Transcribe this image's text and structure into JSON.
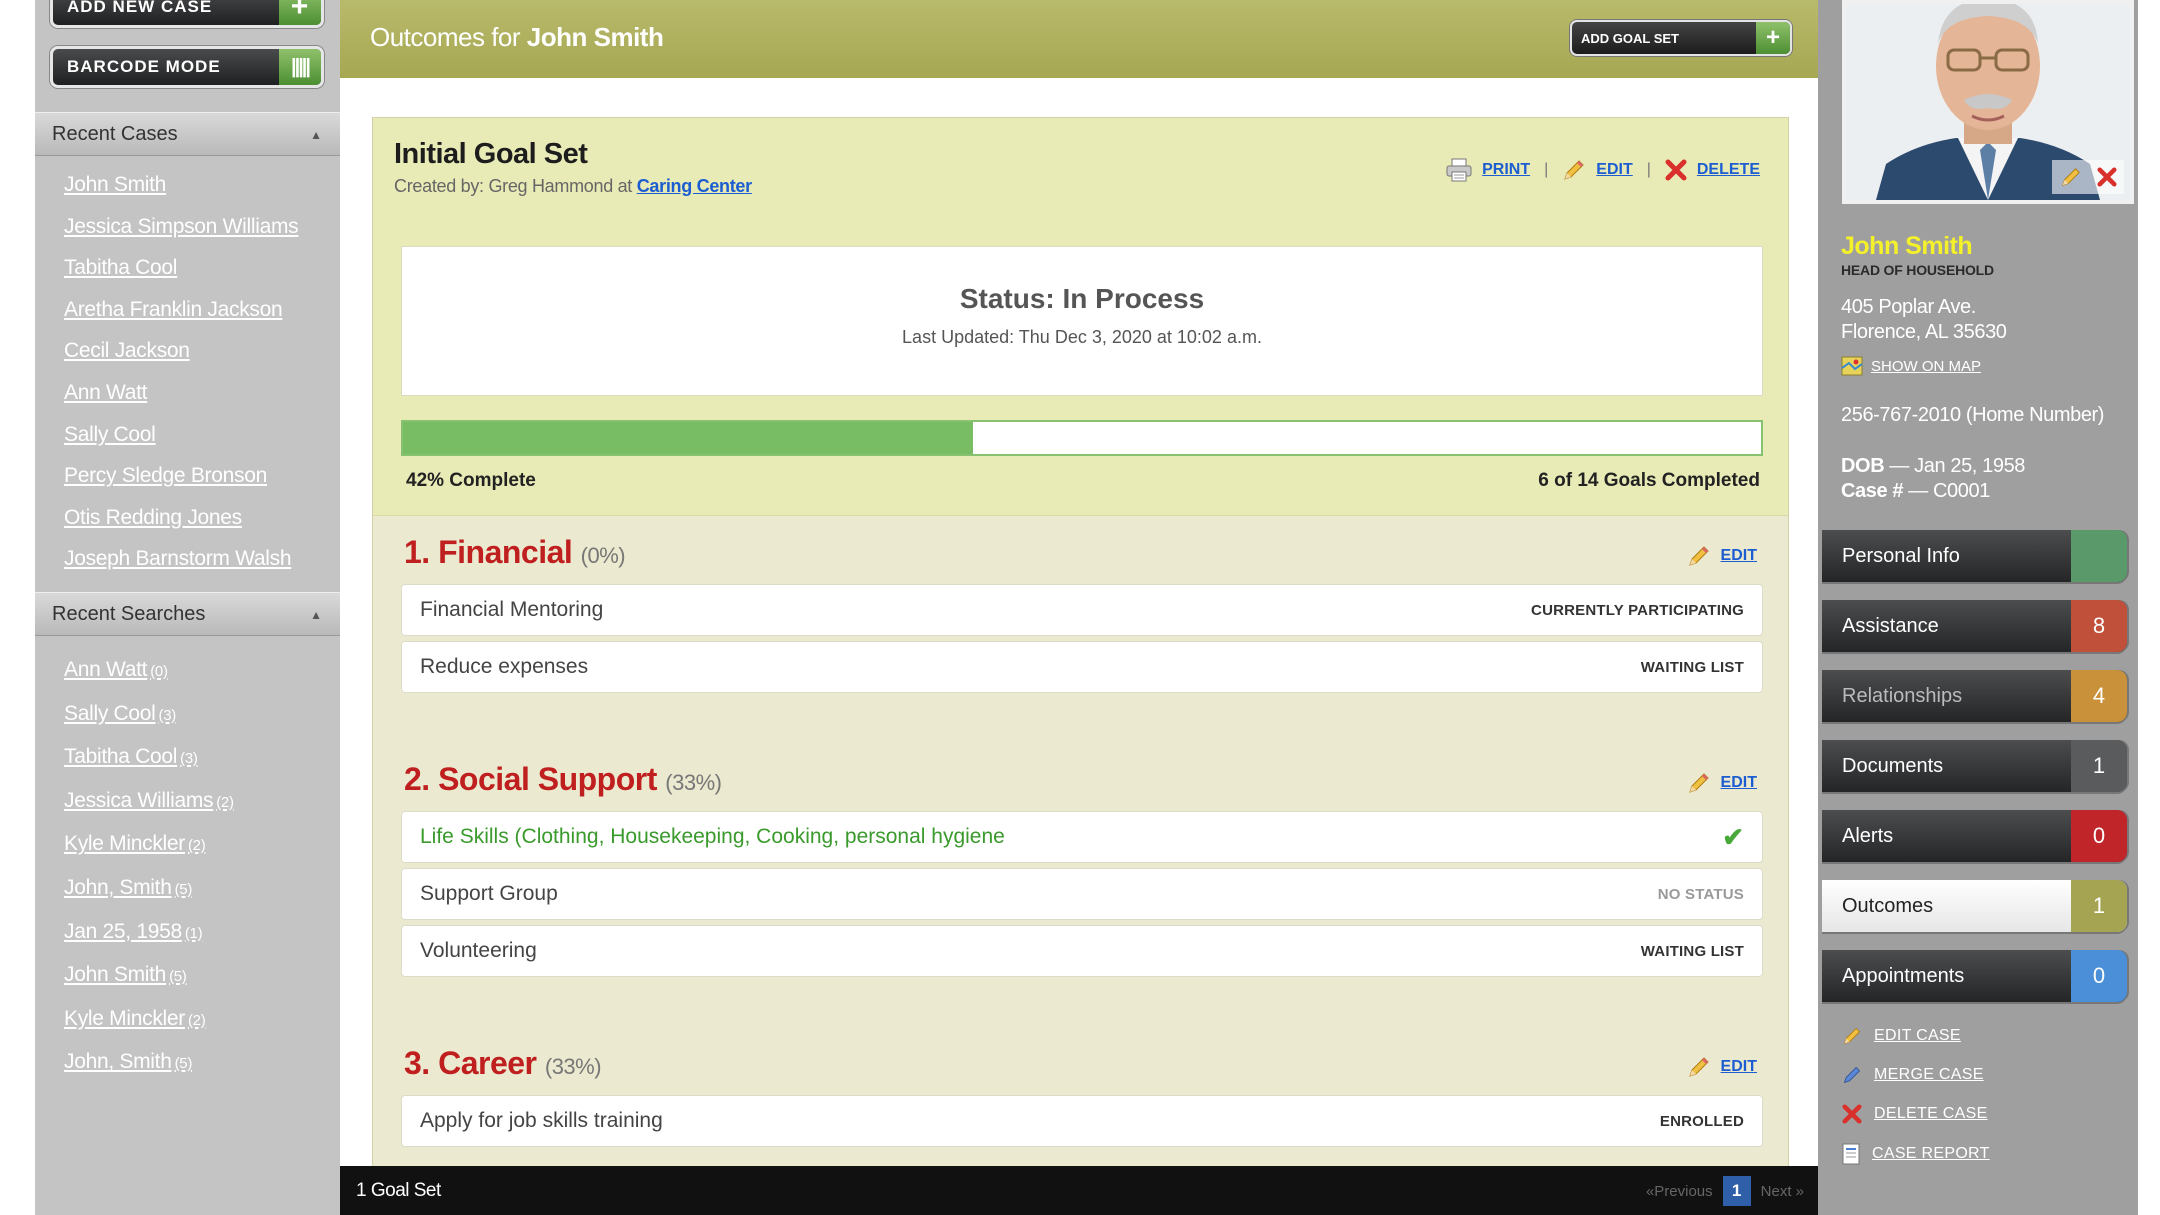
{
  "left_sidebar": {
    "add_new_case": "ADD NEW CASE",
    "barcode_mode": "BARCODE MODE",
    "recent_cases_heading": "Recent Cases",
    "recent_cases": [
      "John Smith",
      "Jessica Simpson Williams",
      "Tabitha Cool",
      "Aretha Franklin Jackson",
      "Cecil Jackson",
      "Ann Watt",
      "Sally Cool",
      "Percy Sledge Bronson",
      "Otis Redding Jones",
      "Joseph Barnstorm Walsh"
    ],
    "recent_searches_heading": "Recent Searches",
    "recent_searches": [
      {
        "label": "Ann Watt",
        "count": "(0)"
      },
      {
        "label": "Sally Cool",
        "count": "(3)"
      },
      {
        "label": "Tabitha Cool",
        "count": "(3)"
      },
      {
        "label": "Jessica Williams",
        "count": "(2)"
      },
      {
        "label": "Kyle Minckler",
        "count": "(2)"
      },
      {
        "label": "John, Smith",
        "count": "(5)"
      },
      {
        "label": "Jan 25, 1958",
        "count": "(1)"
      },
      {
        "label": "John Smith",
        "count": "(5)"
      },
      {
        "label": "Kyle Minckler",
        "count": "(2)"
      },
      {
        "label": "John, Smith",
        "count": "(5)"
      }
    ]
  },
  "header": {
    "title_prefix": "Outcomes for",
    "title_name": "John Smith",
    "add_goal_set": "ADD GOAL SET"
  },
  "goal_set": {
    "title": "Initial Goal Set",
    "created_by_prefix": "Created by: Greg Hammond at",
    "created_by_location": "Caring Center",
    "print": "PRINT",
    "edit": "EDIT",
    "delete": "DELETE",
    "separator": "|",
    "status": "Status: In Process",
    "last_updated": "Last Updated: Thu Dec 3, 2020 at 10:02 a.m.",
    "progress_fraction": 0.42,
    "progress_label": "42% Complete",
    "goals_completed": "6 of 14 Goals Completed",
    "sections": [
      {
        "title": "1. Financial",
        "pct": "(0%)",
        "edit": "EDIT",
        "goals": [
          {
            "name": "Financial Mentoring",
            "status": "CURRENTLY PARTICIPATING"
          },
          {
            "name": "Reduce expenses",
            "status": "WAITING LIST"
          }
        ]
      },
      {
        "title": "2. Social Support",
        "pct": "(33%)",
        "edit": "EDIT",
        "goals": [
          {
            "name": "Life Skills (Clothing, Housekeeping, Cooking, personal hygiene",
            "status": ""
          },
          {
            "name": "Support Group",
            "status": "NO STATUS"
          },
          {
            "name": "Volunteering",
            "status": "WAITING LIST"
          }
        ]
      },
      {
        "title": "3. Career",
        "pct": "(33%)",
        "edit": "EDIT",
        "goals": [
          {
            "name": "Apply for job skills training",
            "status": "ENROLLED"
          }
        ]
      }
    ]
  },
  "pagination": {
    "count": "1 Goal Set",
    "previous": "«Previous",
    "current_page": "1",
    "next": "Next »"
  },
  "profile": {
    "name": "John Smith",
    "role": "HEAD OF HOUSEHOLD",
    "address_line1": "405 Poplar Ave.",
    "address_line2": "Florence, AL  35630",
    "show_on_map": "SHOW ON MAP",
    "phone": "256-767-2010 (Home Number)",
    "dob_label": "DOB",
    "dob_value": " — Jan 25, 1958",
    "case_label": "Case #",
    "case_value": " —  C0001"
  },
  "nav": [
    {
      "label": "Personal Info",
      "badge": "",
      "color": "#5a9a6a"
    },
    {
      "label": "Assistance",
      "badge": "8",
      "color": "#c0503a"
    },
    {
      "label": "Relationships",
      "badge": "4",
      "color": "#c9923a"
    },
    {
      "label": "Documents",
      "badge": "1",
      "color": "#5a5b5c"
    },
    {
      "label": "Alerts",
      "badge": "0",
      "color": "#c0252a"
    },
    {
      "label": "Outcomes",
      "badge": "1",
      "color": "#a5a452"
    },
    {
      "label": "Appointments",
      "badge": "0",
      "color": "#4a8fd8"
    }
  ],
  "case_actions": [
    "EDIT CASE",
    "MERGE CASE",
    "DELETE CASE",
    "CASE REPORT"
  ]
}
